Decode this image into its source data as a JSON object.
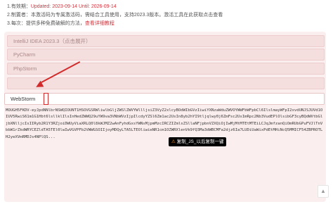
{
  "info": {
    "line1_prefix": "1.有效期：",
    "line1_value": "Updated: 2023-09-14 Until: 2026-09-14",
    "line2": "2.制置者：本激活码为专属激活码，需结合工具使用，支持2023.3版本。激活工具在此获取点击查看",
    "line3_prefix": "3.每次：提供多种免费破解的方法，",
    "line3_link": "查看详细教程"
  },
  "rows": [
    "IntelliJ IDEA 2023.3（点击展开）",
    "PyCharm",
    "PhpStorm",
    ""
  ],
  "webstorm": {
    "label": "WebStorm"
  },
  "code_text": "MOUGH5FKDV-eyJpdNNlbrNSWQIOUNT1HSOVGSRWliwlbGljZWSlZWVYWllljsiZ3VyZ2xlcyBOdWIbGVzIiwiYXNzaWduZWVOYWWFbWFpbCl6IlslmayWFpI2xvdUNJSJUVd1OIUV5RwiS61m1G1Hbt6lsllklIlsInHedZWWQ29uYW9va3VNbWVzIjpIlcdyYZSl6Zm1ac2UsIn8yb2hYI9tljqlwy0j6ZmFsc2UsImRpc2Nb3VudEPlOlsibGF3cyBQdWVtbGljbXNlljcIsIIRyb2R1Y3RZjoiDWUyViaXRLQ0l8kWJMZ2wAnFyhdGxsYWNsMjpmMzcIRCZIZmlsZSllaNFjpbnVZXQiOjIwMjMtMTEtMTEiLCJqJmfzanQiOmRUbGPuFVJlTnVbbW1rZkdWRYCEZldTA5TEl0lwIwVGVPFb2VWWGSOIIjoyMDQyLTA5LTEOliwieNR1cm1OZWRXlenVk9fQ3Ma3dWBCMFa2djz6Ia7LUDiUaWixPdEtMHiNcQ5MMICF54ZBPROTLH2yeXVmRMDJs4NPlQS...",
  "copy_button": {
    "text": "复制_JS_以后复制一键"
  },
  "scroll_top": "▲"
}
